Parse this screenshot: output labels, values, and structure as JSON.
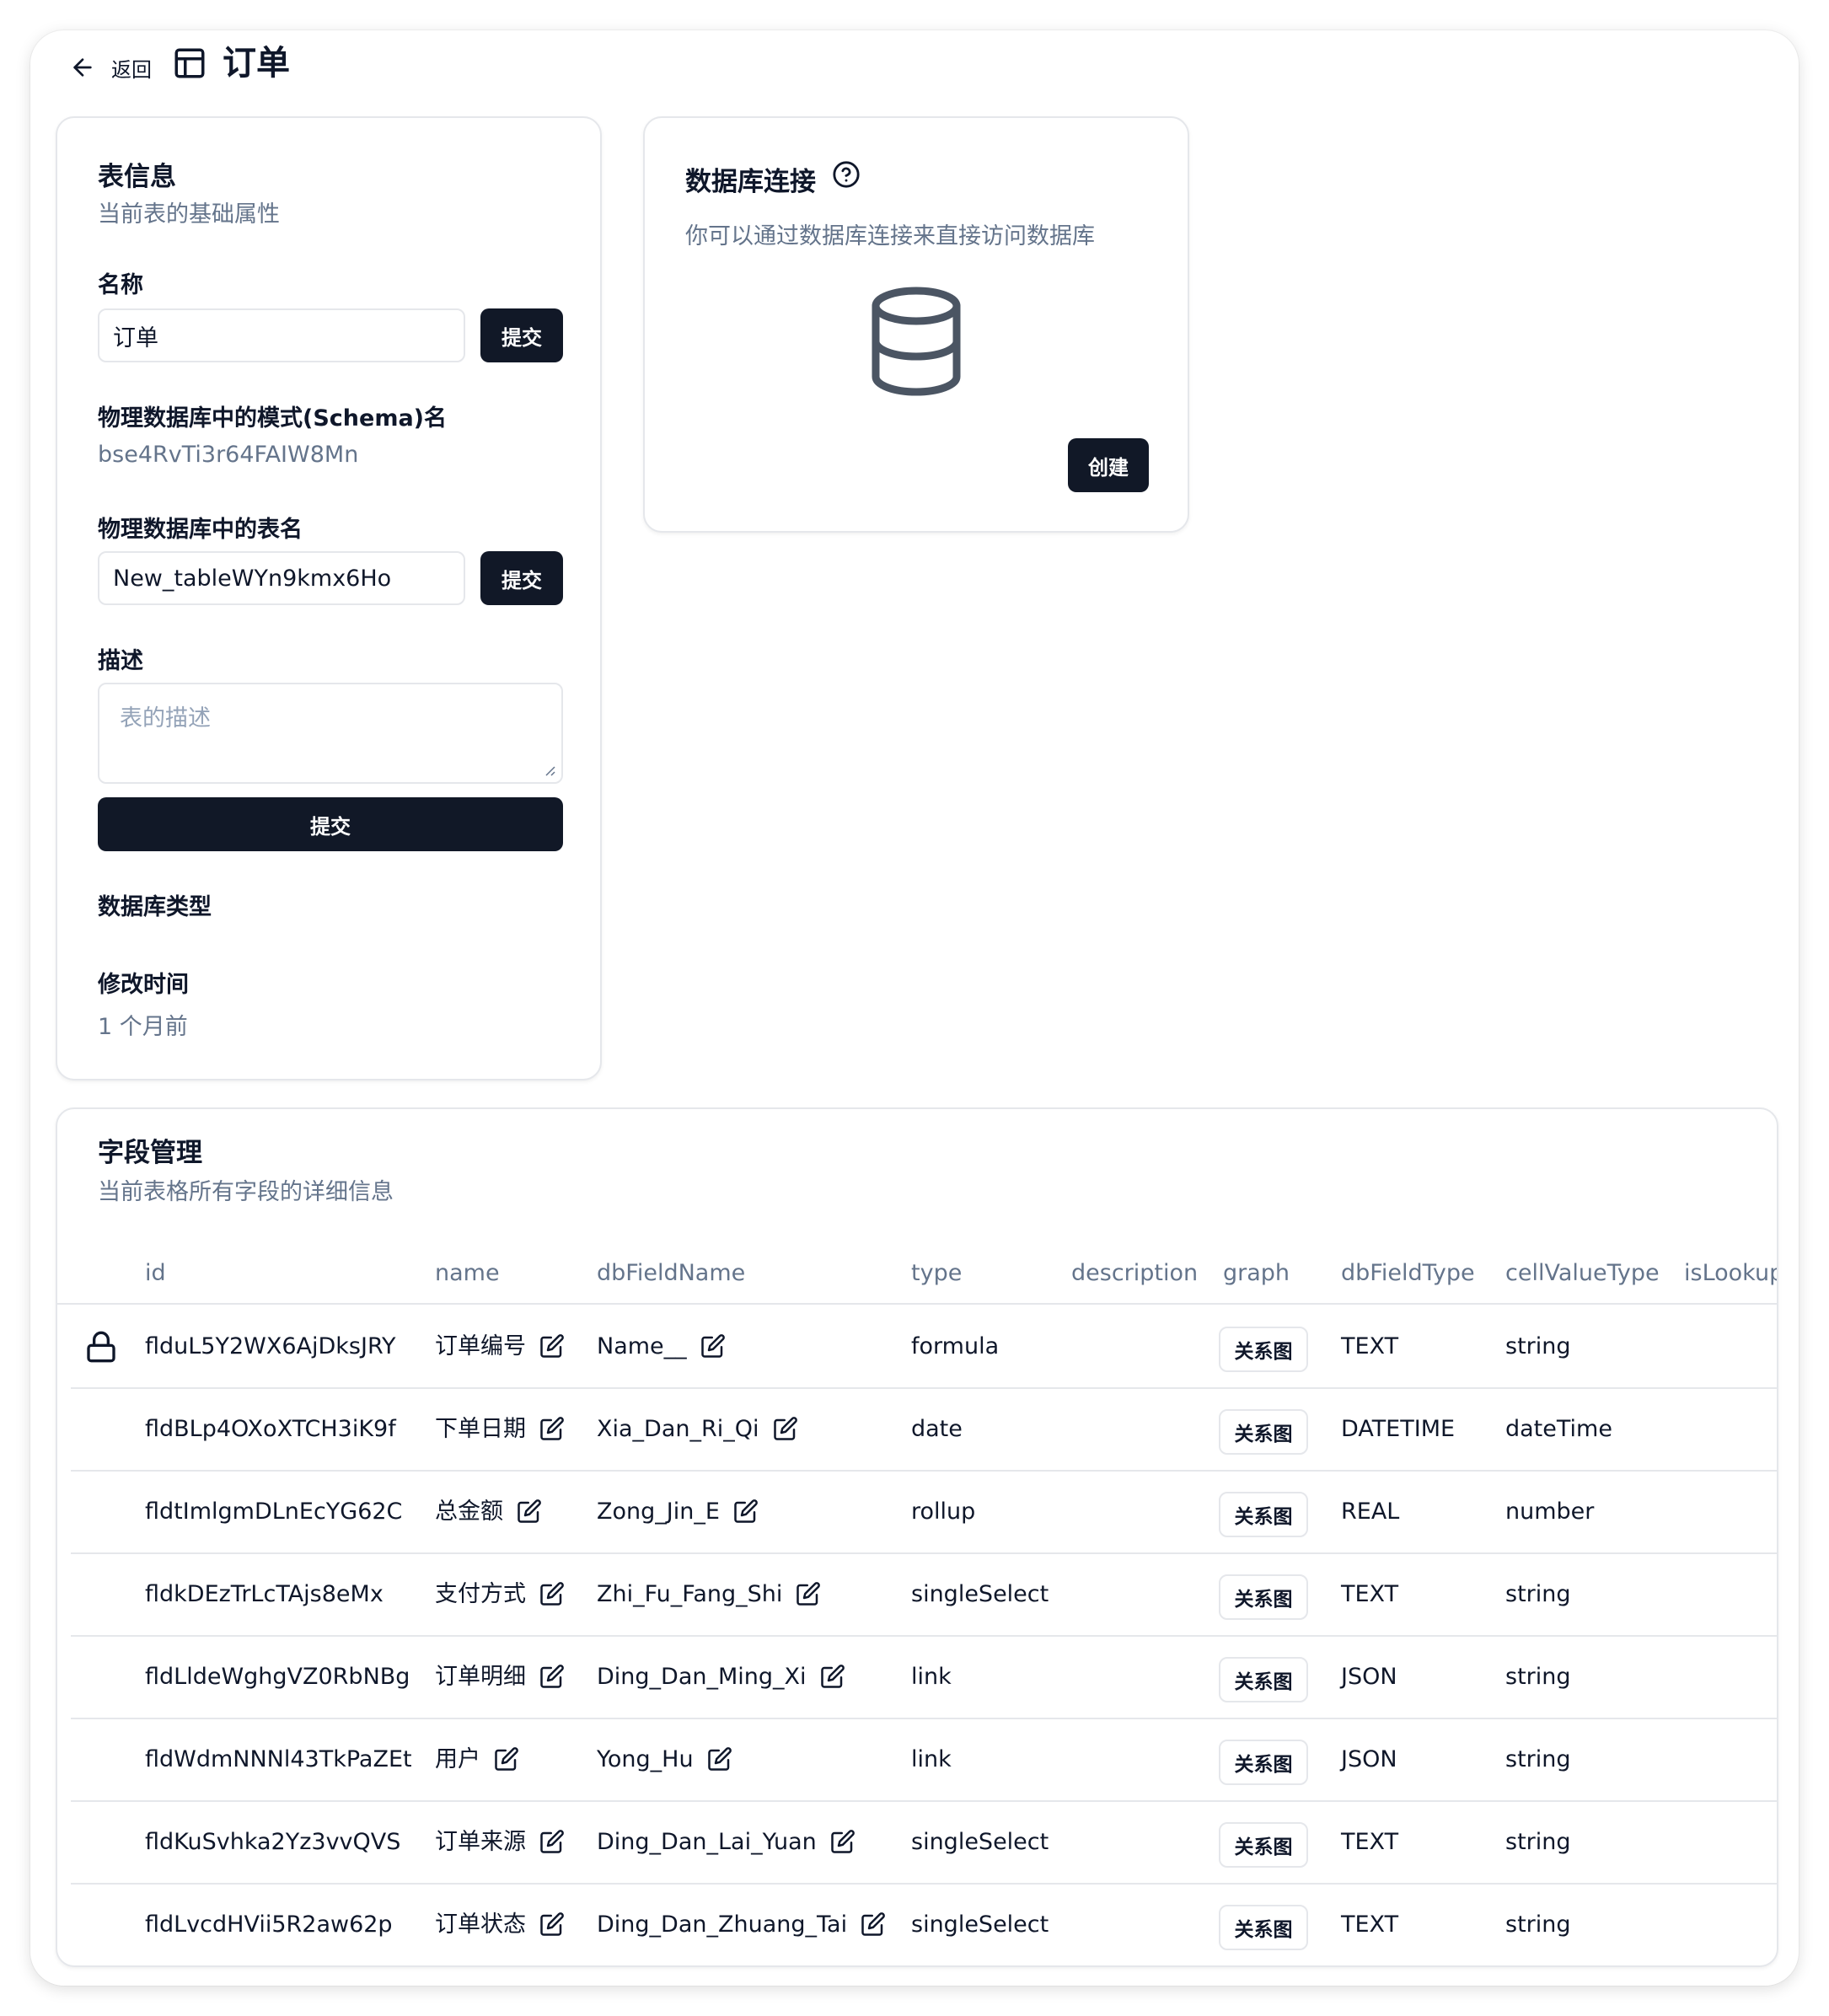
{
  "header": {
    "back_label": "返回",
    "title": "订单"
  },
  "table_info": {
    "title": "表信息",
    "subtitle": "当前表的基础属性",
    "name_label": "名称",
    "name_value": "订单",
    "submit_label": "提交",
    "schema_label": "物理数据库中的模式(Schema)名",
    "schema_value": "bse4RvTi3r64FAIW8Mn",
    "db_table_label": "物理数据库中的表名",
    "db_table_value": "New_tableWYn9kmx6Ho",
    "description_label": "描述",
    "description_placeholder": "表的描述",
    "db_type_label": "数据库类型",
    "modified_label": "修改时间",
    "modified_value": "1 个月前"
  },
  "db_connection": {
    "title": "数据库连接",
    "subtitle": "你可以通过数据库连接来直接访问数据库",
    "create_label": "创建"
  },
  "fields": {
    "title": "字段管理",
    "subtitle": "当前表格所有字段的详细信息",
    "columns": [
      "id",
      "name",
      "dbFieldName",
      "type",
      "description",
      "graph",
      "dbFieldType",
      "cellValueType",
      "isLookup"
    ],
    "graph_label": "关系图",
    "rows": [
      {
        "locked": true,
        "id": "flduL5Y2WX6AjDksJRY",
        "name": "订单编号",
        "dbFieldName": "Name__",
        "type": "formula",
        "dbFieldType": "TEXT",
        "cellValueType": "string"
      },
      {
        "locked": false,
        "id": "fldBLp4OXoXTCH3iK9f",
        "name": "下单日期",
        "dbFieldName": "Xia_Dan_Ri_Qi",
        "type": "date",
        "dbFieldType": "DATETIME",
        "cellValueType": "dateTime"
      },
      {
        "locked": false,
        "id": "fldtImlgmDLnEcYG62C",
        "name": "总金额",
        "dbFieldName": "Zong_Jin_E",
        "type": "rollup",
        "dbFieldType": "REAL",
        "cellValueType": "number"
      },
      {
        "locked": false,
        "id": "fldkDEzTrLcTAjs8eMx",
        "name": "支付方式",
        "dbFieldName": "Zhi_Fu_Fang_Shi",
        "type": "singleSelect",
        "dbFieldType": "TEXT",
        "cellValueType": "string"
      },
      {
        "locked": false,
        "id": "fldLldeWghgVZ0RbNBg",
        "name": "订单明细",
        "dbFieldName": "Ding_Dan_Ming_Xi",
        "type": "link",
        "dbFieldType": "JSON",
        "cellValueType": "string"
      },
      {
        "locked": false,
        "id": "fldWdmNNNl43TkPaZEt",
        "name": "用户",
        "dbFieldName": "Yong_Hu",
        "type": "link",
        "dbFieldType": "JSON",
        "cellValueType": "string"
      },
      {
        "locked": false,
        "id": "fldKuSvhka2Yz3vvQVS",
        "name": "订单来源",
        "dbFieldName": "Ding_Dan_Lai_Yuan",
        "type": "singleSelect",
        "dbFieldType": "TEXT",
        "cellValueType": "string"
      },
      {
        "locked": false,
        "id": "fldLvcdHVii5R2aw62p",
        "name": "订单状态",
        "dbFieldName": "Ding_Dan_Zhuang_Tai",
        "type": "singleSelect",
        "dbFieldType": "TEXT",
        "cellValueType": "string"
      }
    ]
  },
  "colors": {
    "primary_button": "#111827",
    "muted_text": "#64748b",
    "border": "#e5e7eb"
  },
  "icons": [
    "arrow-left-icon",
    "table-icon",
    "help-circle-icon",
    "database-icon",
    "lock-icon",
    "edit-icon"
  ]
}
